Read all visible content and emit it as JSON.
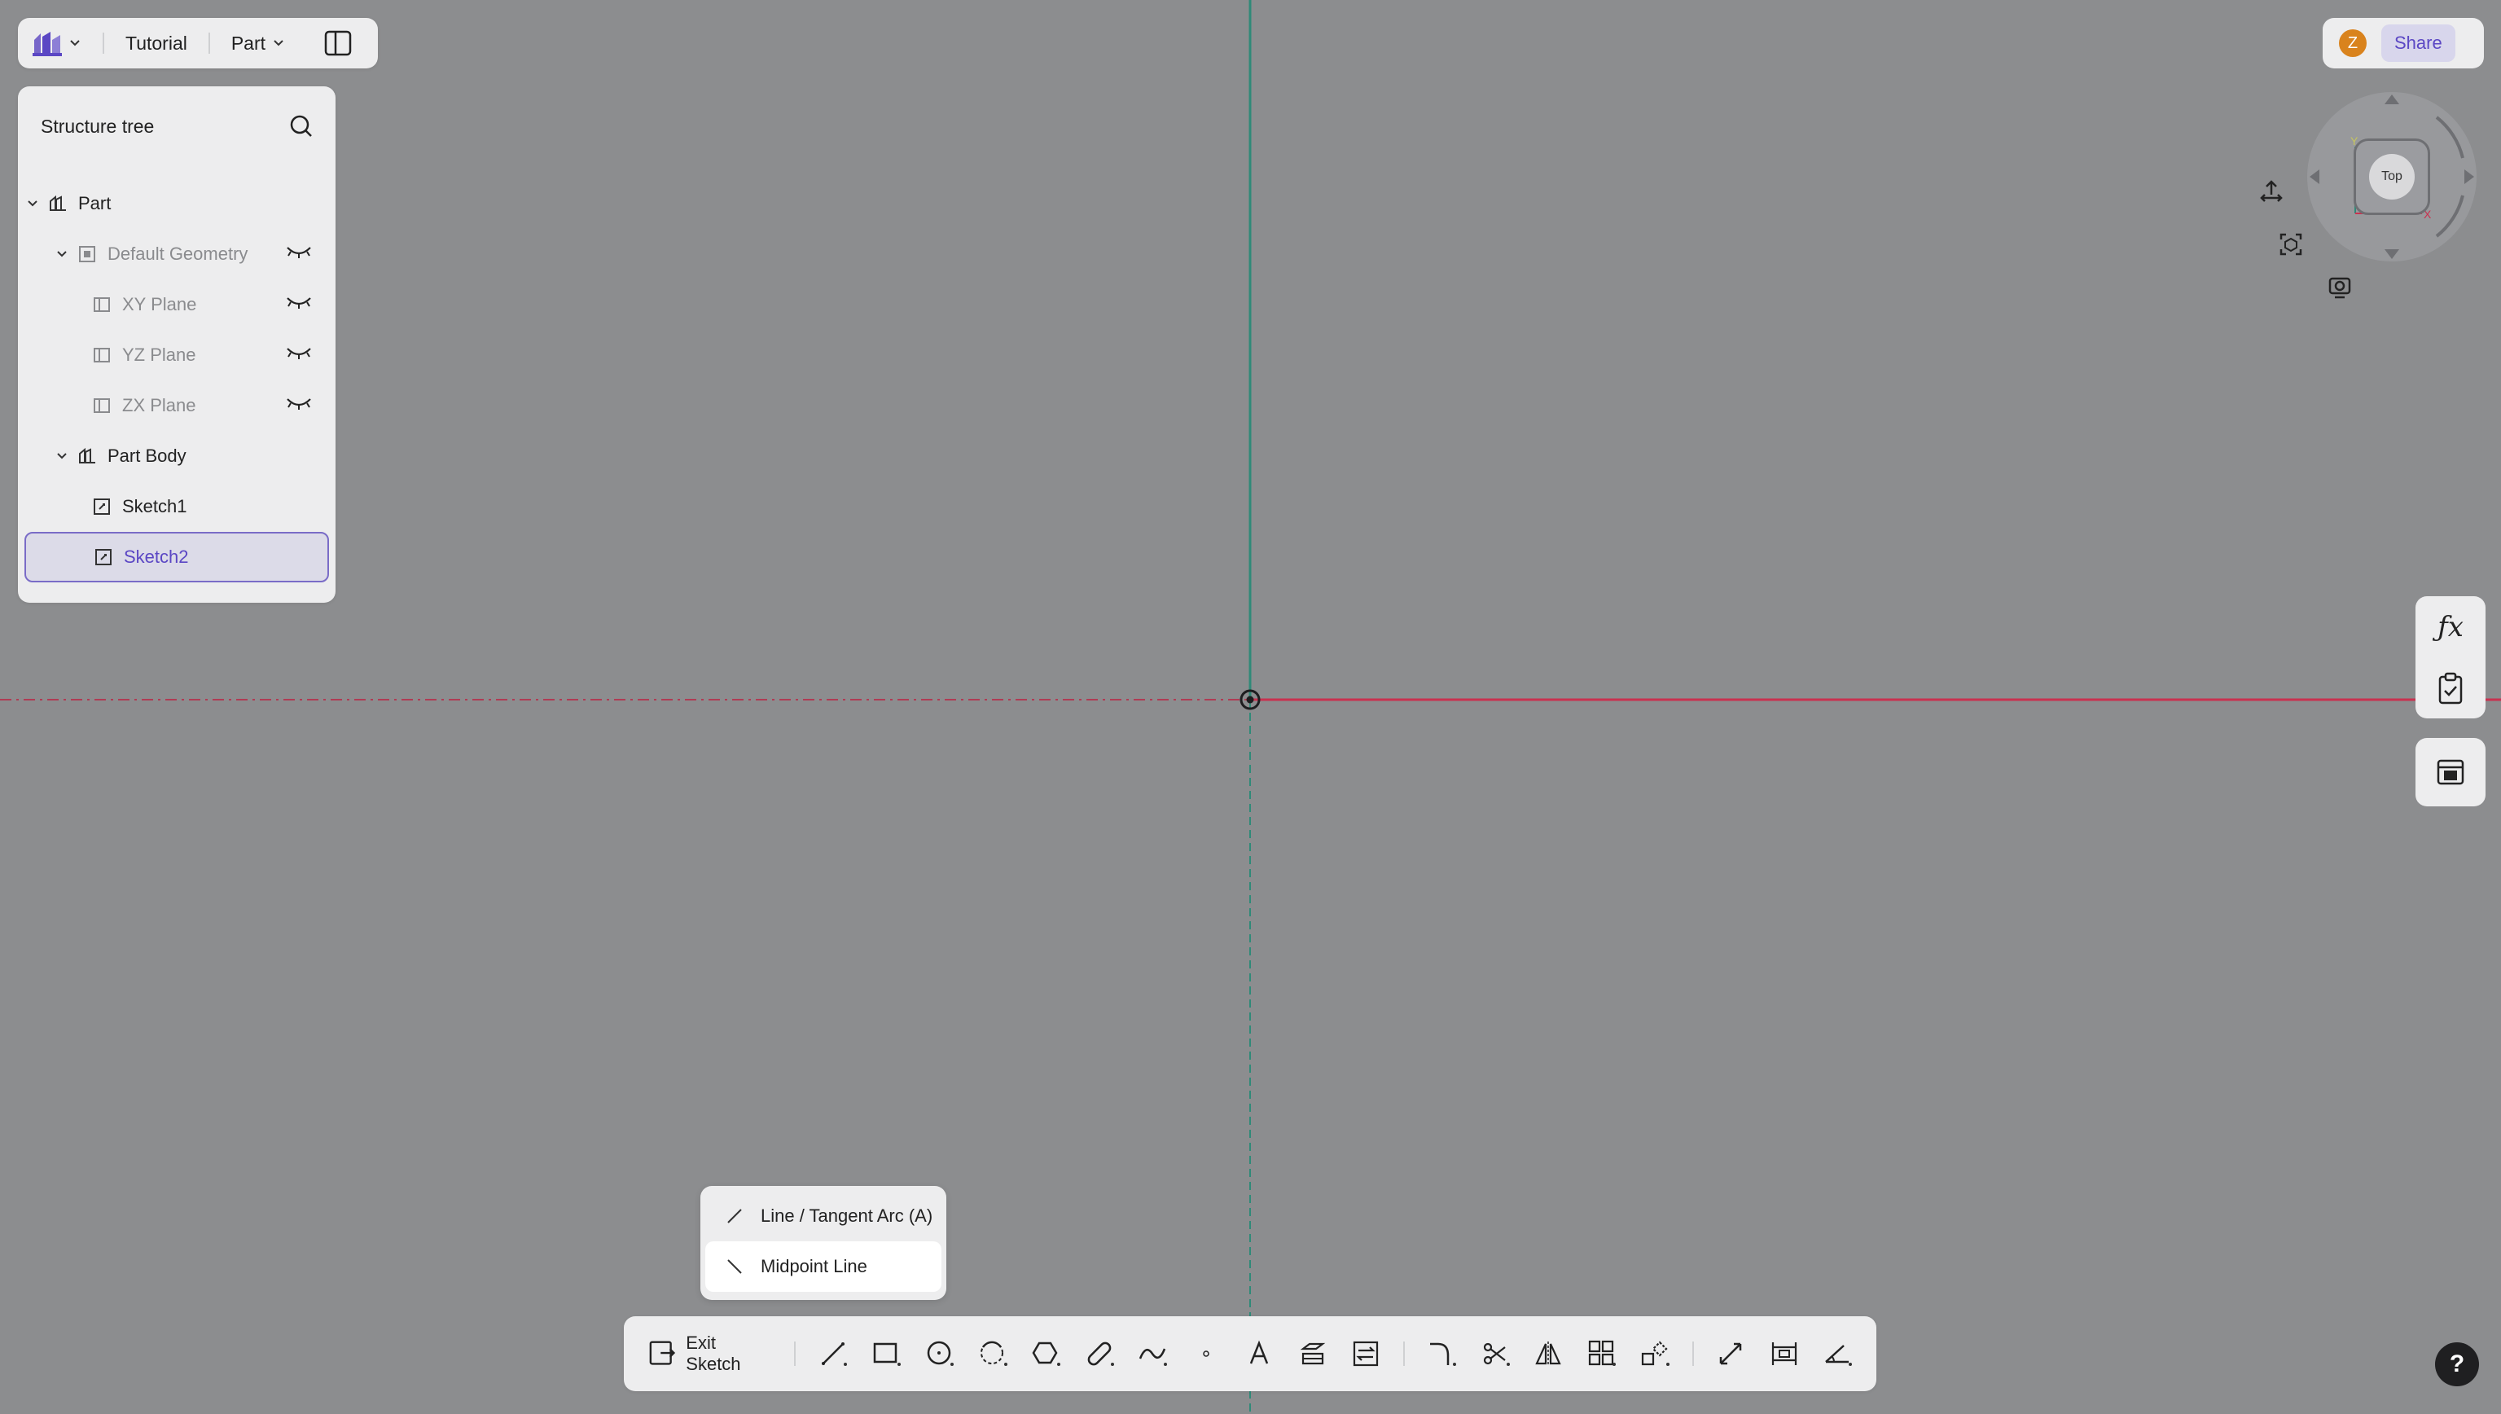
{
  "topbar": {
    "workspace": "Tutorial",
    "mode": "Part"
  },
  "tree": {
    "title": "Structure tree",
    "items": [
      {
        "label": "Part"
      },
      {
        "label": "Default Geometry"
      },
      {
        "label": "XY Plane"
      },
      {
        "label": "YZ Plane"
      },
      {
        "label": "ZX Plane"
      },
      {
        "label": "Part Body"
      },
      {
        "label": "Sketch1"
      },
      {
        "label": "Sketch2"
      }
    ]
  },
  "user": {
    "avatar_initial": "Z",
    "share_label": "Share"
  },
  "viewcube": {
    "face_label": "Top",
    "axis_y": "Y",
    "axis_x": "X"
  },
  "menu": {
    "items": [
      {
        "label": "Line / Tangent Arc (A)"
      },
      {
        "label": "Midpoint Line"
      }
    ]
  },
  "toolbar": {
    "exit_label": "Exit Sketch"
  },
  "help": {
    "label": "?"
  },
  "colors": {
    "accent": "#5b47c4",
    "x_axis": "#c9314f",
    "y_axis": "#2f8a78",
    "canvas": "#8c8d8f"
  }
}
